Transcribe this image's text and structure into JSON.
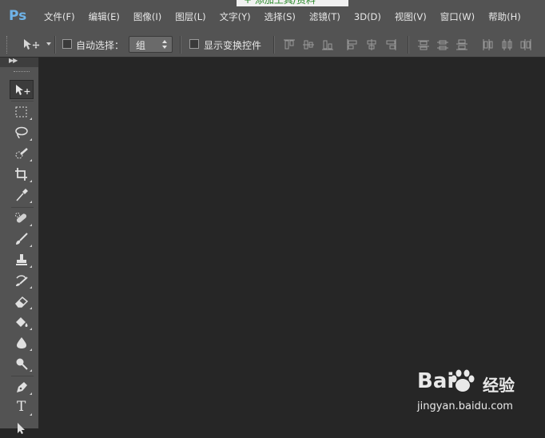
{
  "app": {
    "logo": "Ps"
  },
  "menu": {
    "items": [
      "文件(F)",
      "编辑(E)",
      "图像(I)",
      "图层(L)",
      "文字(Y)",
      "选择(S)",
      "滤镜(T)",
      "3D(D)",
      "视图(V)",
      "窗口(W)",
      "帮助(H)"
    ]
  },
  "top_strip": {
    "text": "+ 添加工具/资料"
  },
  "options": {
    "auto_select_label": "自动选择：",
    "auto_select_checked": false,
    "auto_select_target": "组",
    "show_transform_label": "显示变换控件",
    "show_transform_checked": false
  },
  "tools": [
    {
      "name": "move-tool",
      "icon": "move-icon",
      "active": true
    },
    {
      "name": "marquee-tool",
      "icon": "rectangular-marquee-icon"
    },
    {
      "name": "lasso-tool",
      "icon": "lasso-icon"
    },
    {
      "name": "quick-select-tool",
      "icon": "quick-selection-icon"
    },
    {
      "name": "crop-tool",
      "icon": "crop-icon"
    },
    {
      "name": "eyedropper-tool",
      "icon": "eyedropper-icon"
    },
    {
      "name": "healing-brush-tool",
      "icon": "spot-healing-icon"
    },
    {
      "name": "brush-tool",
      "icon": "brush-icon"
    },
    {
      "name": "clone-stamp-tool",
      "icon": "clone-stamp-icon"
    },
    {
      "name": "history-brush-tool",
      "icon": "history-brush-icon"
    },
    {
      "name": "eraser-tool",
      "icon": "eraser-icon"
    },
    {
      "name": "paint-bucket-tool",
      "icon": "paint-bucket-icon"
    },
    {
      "name": "blur-tool",
      "icon": "blur-drop-icon"
    },
    {
      "name": "dodge-tool",
      "icon": "dodge-icon"
    },
    {
      "name": "pen-tool",
      "icon": "pen-icon"
    },
    {
      "name": "type-tool",
      "icon": "type-icon",
      "glyph": "T"
    },
    {
      "name": "path-select-tool",
      "icon": "path-selection-icon"
    }
  ],
  "watermark": {
    "brand_left": "Bai",
    "brand_right": "经验",
    "url": "jingyan.baidu.com"
  }
}
